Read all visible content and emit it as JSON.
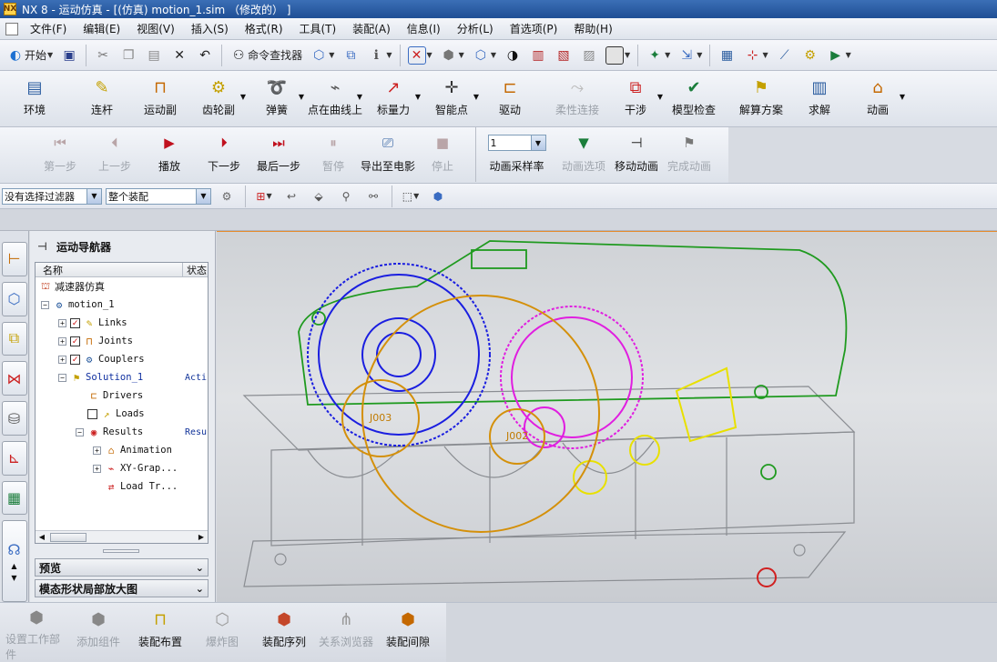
{
  "window": {
    "title": "NX 8 - 运动仿真 - [(仿真) motion_1.sim （修改的） ]"
  },
  "menu": [
    "文件(F)",
    "编辑(E)",
    "视图(V)",
    "插入(S)",
    "格式(R)",
    "工具(T)",
    "装配(A)",
    "信息(I)",
    "分析(L)",
    "首选项(P)",
    "帮助(H)"
  ],
  "std_toolbar": {
    "start_label": "开始",
    "command_finder_label": "命令查找器"
  },
  "motion_toolbar": [
    {
      "label": "环境",
      "icon": "environment-icon"
    },
    {
      "label": "连杆",
      "icon": "link-icon"
    },
    {
      "label": "运动副",
      "icon": "joint-icon"
    },
    {
      "label": "齿轮副",
      "icon": "gear-pair-icon"
    },
    {
      "label": "弹簧",
      "icon": "spring-icon"
    },
    {
      "label": "点在曲线上",
      "icon": "point-on-curve-icon"
    },
    {
      "label": "标量力",
      "icon": "scalar-force-icon"
    },
    {
      "label": "智能点",
      "icon": "smart-point-icon"
    },
    {
      "label": "驱动",
      "icon": "driver-icon"
    },
    {
      "label": "柔性连接",
      "icon": "flexible-link-icon",
      "disabled": true
    },
    {
      "label": "干涉",
      "icon": "interference-icon"
    },
    {
      "label": "模型检查",
      "icon": "model-check-icon"
    },
    {
      "label": "解算方案",
      "icon": "solution-icon"
    },
    {
      "label": "求解",
      "icon": "solve-icon"
    },
    {
      "label": "动画",
      "icon": "animation-icon"
    }
  ],
  "animation_toolbar": {
    "buttons": [
      {
        "label": "第一步",
        "icon": "first-step-icon",
        "disabled": true
      },
      {
        "label": "上一步",
        "icon": "prev-step-icon",
        "disabled": true
      },
      {
        "label": "播放",
        "icon": "play-icon"
      },
      {
        "label": "下一步",
        "icon": "next-step-icon"
      },
      {
        "label": "最后一步",
        "icon": "last-step-icon"
      },
      {
        "label": "暂停",
        "icon": "pause-icon",
        "disabled": true
      },
      {
        "label": "导出至电影",
        "icon": "export-movie-icon"
      },
      {
        "label": "停止",
        "icon": "stop-icon",
        "disabled": true
      }
    ],
    "sample_rate_value": "1",
    "sample_rate_label": "动画采样率",
    "anim_options_label": "动画选项",
    "move_anim_label": "移动动画",
    "finish_anim_label": "完成动画"
  },
  "selection_bar": {
    "filter_value": "没有选择过滤器",
    "scope_value": "整个装配"
  },
  "navigator": {
    "title": "运动导航器",
    "col_name": "名称",
    "col_status": "状态",
    "root": "减速器仿真",
    "rows": [
      {
        "label": "motion_1",
        "indent": 0,
        "expander": "⊟",
        "status": ""
      },
      {
        "label": "Links",
        "indent": 1,
        "expander": "+",
        "check": true,
        "status": ""
      },
      {
        "label": "Joints",
        "indent": 1,
        "expander": "+",
        "check": true,
        "status": ""
      },
      {
        "label": "Couplers",
        "indent": 1,
        "expander": "+",
        "check": true,
        "status": ""
      },
      {
        "label": "Solution_1",
        "indent": 1,
        "expander": "⊟",
        "status": "Acti",
        "blue": true
      },
      {
        "label": "Drivers",
        "indent": 2,
        "status": ""
      },
      {
        "label": "Loads",
        "indent": 2,
        "check": false,
        "status": ""
      },
      {
        "label": "Results",
        "indent": 2,
        "expander": "⊟",
        "status": "Resu"
      },
      {
        "label": "Animation",
        "indent": 3,
        "expander": "+",
        "status": ""
      },
      {
        "label": "XY-Grap...",
        "indent": 3,
        "expander": "+",
        "status": ""
      },
      {
        "label": "Load Tr...",
        "indent": 3,
        "status": ""
      }
    ],
    "preview_label": "预览",
    "mode_shape_label": "模态形状局部放大图"
  },
  "viewport_labels": {
    "joint_a": "J003",
    "joint_b": "J002"
  },
  "bottom_toolbar": [
    {
      "label": "设置工作部件",
      "disabled": true
    },
    {
      "label": "添加组件",
      "disabled": true
    },
    {
      "label": "装配布置"
    },
    {
      "label": "爆炸图",
      "disabled": true
    },
    {
      "label": "装配序列"
    },
    {
      "label": "关系浏览器",
      "disabled": true
    },
    {
      "label": "装配间隙"
    }
  ]
}
